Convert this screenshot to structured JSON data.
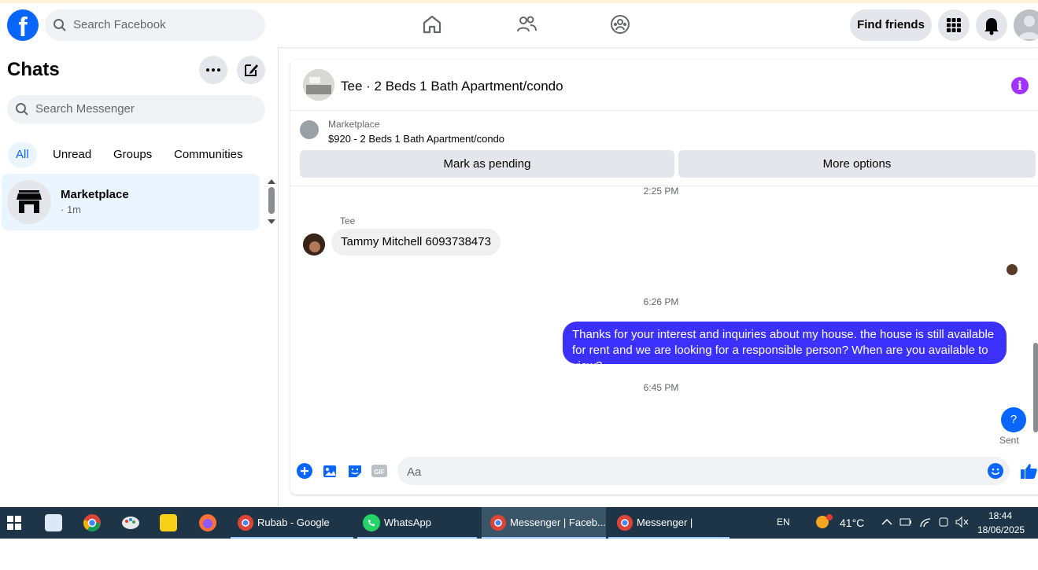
{
  "topbar": {
    "search_placeholder": "Search Facebook",
    "find_friends_label": "Find friends",
    "icons": [
      "facebook-logo-icon",
      "search-icon",
      "home-icon",
      "friends-icon",
      "groups-icon",
      "menu-grid-icon",
      "bell-icon",
      "profile-avatar-icon"
    ]
  },
  "sidebar": {
    "title": "Chats",
    "search_placeholder": "Search Messenger",
    "tabs": [
      {
        "label": "All",
        "active": true
      },
      {
        "label": "Unread",
        "active": false
      },
      {
        "label": "Groups",
        "active": false
      },
      {
        "label": "Communities",
        "active": false
      }
    ],
    "chats": [
      {
        "name": "Marketplace",
        "time": "· 1m",
        "icon": "marketplace-store-icon"
      }
    ]
  },
  "conversation": {
    "title": "Tee · 2 Beds 1 Bath Apartment/condo",
    "marketplace_label": "Marketplace",
    "listing_price_title": "$920 - 2 Beds 1 Bath Apartment/condo",
    "mark_pending_label": "Mark as pending",
    "more_options_label": "More options",
    "messages": {
      "ts1": "2:25 PM",
      "sender_name": "Tee",
      "incoming_text": "Tammy Mitchell 6093738473",
      "ts2": "6:26 PM",
      "outgoing_text": "Thanks for your interest and inquiries about my house. the house is still available for rent and we are looking for a responsible person? When are you available to view?",
      "ts3": "6:45 PM",
      "help_symbol": "?",
      "sent_label": "Sent"
    },
    "composer_placeholder": "Aa",
    "colors": {
      "accent": "#0866ff",
      "outgoing_bubble": "#3c30ff",
      "info": "#a033ff"
    }
  },
  "taskbar": {
    "apps": [
      {
        "label": "Rubab - Google Sh..."
      },
      {
        "label": "WhatsApp"
      },
      {
        "label": "Messenger | Faceb..."
      },
      {
        "label": "Messenger | Faceb..."
      }
    ],
    "lang": "EN",
    "temperature": "41°C",
    "time": "18:44",
    "date": "18/06/2025"
  }
}
